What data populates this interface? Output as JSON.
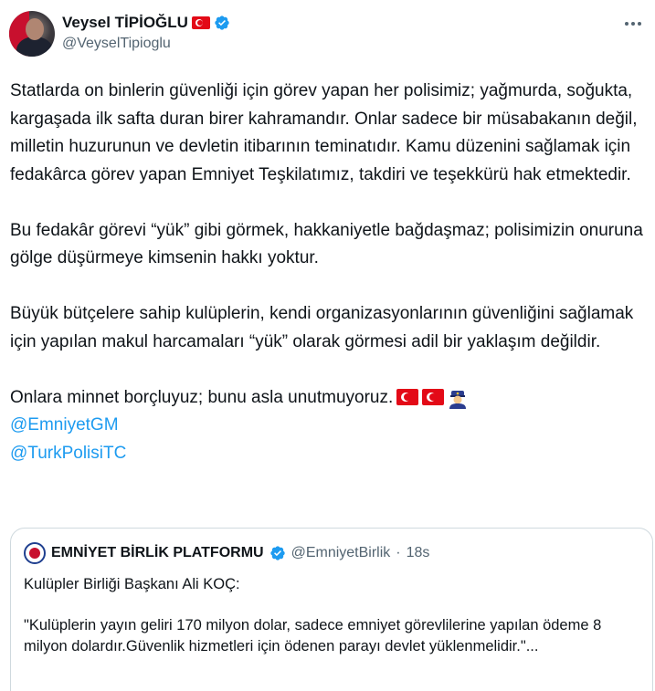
{
  "author": {
    "display_name": "Veysel TİPİOĞLU",
    "handle": "@VeyselTipioglu",
    "avatar_icon": "profile-photo",
    "verified_icon": "verified-badge-icon",
    "flag_icon": "turkey-flag-icon"
  },
  "tweet": {
    "paragraphs": [
      "Statlarda on binlerin güvenliği için görev yapan her polisimiz; yağmurda, soğukta, kargaşada ilk safta duran birer kahramandır. Onlar sadece bir müsabakanın değil, milletin huzurunun ve devletin itibarının teminatıdır. Kamu düzenini sağlamak için fedakârca görev yapan Emniyet Teşkilatımız, takdiri ve teşekkürü hak etmektedir.",
      "Bu fedakâr görevi “yük” gibi görmek, hakkaniyetle bağdaşmaz; polisimizin onuruna gölge düşürmeye kimsenin hakkı yoktur.",
      "Büyük bütçelere sahip kulüplerin, kendi organizasyonlarının güvenliğini sağlamak için yapılan makul harcamaları “yük” olarak görmesi adil bir yaklaşım değildir.",
      "Onlara minnet borçluyuz; bunu asla unutmuyoruz."
    ],
    "trailing_emojis": [
      "turkey-flag-icon",
      "turkey-flag-icon",
      "police-officer-icon"
    ],
    "mentions": [
      "@EmniyetGM",
      "@TurkPolisiTC"
    ]
  },
  "quoted_tweet": {
    "display_name": "EMNİYET BİRLİK PLATFORMU",
    "handle": "@EmniyetBirlik",
    "separator": "·",
    "time": "18s",
    "logo_icon": "organization-logo",
    "lines": [
      "Kulüpler Birliği Başkanı Ali KOÇ:",
      "\"Kulüplerin yayın geliri 170 milyon dolar, sadece emniyet görevlilerine yapılan ödeme 8 milyon dolardır.Güvenlik hizmetleri için ödenen parayı devlet yüklenmelidir.\"..."
    ]
  },
  "colors": {
    "link": "#1d9bf0",
    "text": "#0f1419",
    "secondary": "#536471",
    "border": "#cfd9de",
    "verified": "#1d9bf0"
  }
}
